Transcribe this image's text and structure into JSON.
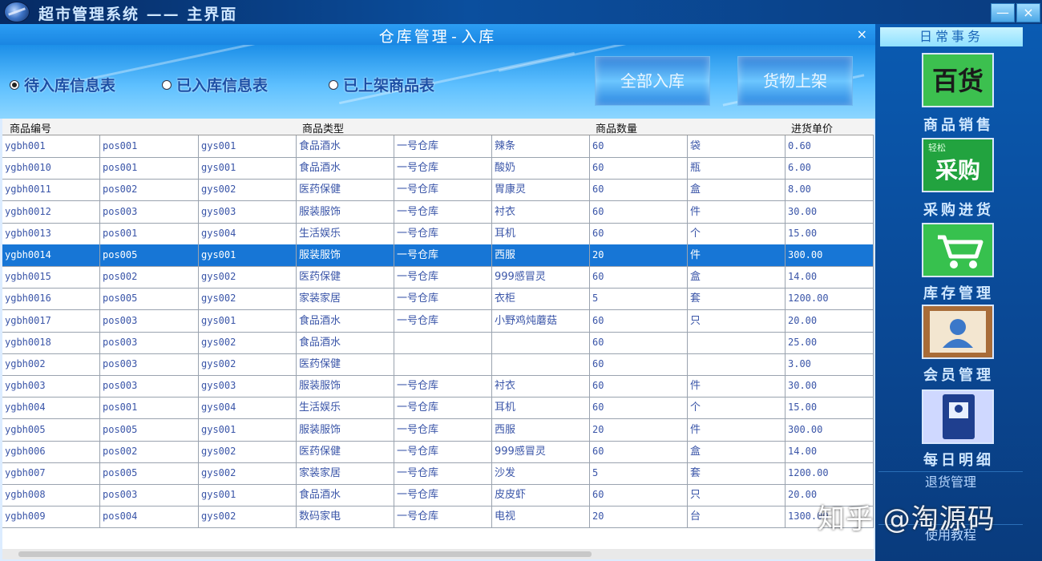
{
  "window": {
    "title": "超市管理系统 —— 主界面",
    "minimize": "—",
    "close": "×"
  },
  "panel": {
    "title": "仓库管理-入库",
    "close": "×",
    "radios": [
      {
        "label": "待入库信息表",
        "checked": true
      },
      {
        "label": "已入库信息表",
        "checked": false
      },
      {
        "label": "已上架商品表",
        "checked": false
      }
    ],
    "buttons": {
      "stock_in_all": "全部入库",
      "shelve_goods": "货物上架"
    }
  },
  "table": {
    "headers": [
      "商品编号",
      "",
      "",
      "商品类型",
      "",
      "",
      "商品数量",
      "",
      "进货单价"
    ],
    "selected_row": 5,
    "rows": [
      [
        "ygbh001",
        "pos001",
        "gys001",
        "食品酒水",
        "一号仓库",
        "辣条",
        "60",
        "袋",
        "0.60"
      ],
      [
        "ygbh0010",
        "pos001",
        "gys001",
        "食品酒水",
        "一号仓库",
        "酸奶",
        "60",
        "瓶",
        "6.00"
      ],
      [
        "ygbh0011",
        "pos002",
        "gys002",
        "医药保健",
        "一号仓库",
        "胃康灵",
        "60",
        "盒",
        "8.00"
      ],
      [
        "ygbh0012",
        "pos003",
        "gys003",
        "服装服饰",
        "一号仓库",
        "衬衣",
        "60",
        "件",
        "30.00"
      ],
      [
        "ygbh0013",
        "pos001",
        "gys004",
        "生活娱乐",
        "一号仓库",
        "耳机",
        "60",
        "个",
        "15.00"
      ],
      [
        "ygbh0014",
        "pos005",
        "gys001",
        "服装服饰",
        "一号仓库",
        "西服",
        "20",
        "件",
        "300.00"
      ],
      [
        "ygbh0015",
        "pos002",
        "gys002",
        "医药保健",
        "一号仓库",
        "999感冒灵",
        "60",
        "盒",
        "14.00"
      ],
      [
        "ygbh0016",
        "pos005",
        "gys002",
        "家装家居",
        "一号仓库",
        "衣柜",
        "5",
        "套",
        "1200.00"
      ],
      [
        "ygbh0017",
        "pos003",
        "gys001",
        "食品酒水",
        "一号仓库",
        "小野鸡炖蘑菇",
        "60",
        "只",
        "20.00"
      ],
      [
        "ygbh0018",
        "pos003",
        "gys002",
        "食品酒水",
        "",
        "",
        "60",
        "",
        "25.00"
      ],
      [
        "ygbh002",
        "pos003",
        "gys002",
        "医药保健",
        "",
        "",
        "60",
        "",
        "3.00"
      ],
      [
        "ygbh003",
        "pos003",
        "gys003",
        "服装服饰",
        "一号仓库",
        "衬衣",
        "60",
        "件",
        "30.00"
      ],
      [
        "ygbh004",
        "pos001",
        "gys004",
        "生活娱乐",
        "一号仓库",
        "耳机",
        "60",
        "个",
        "15.00"
      ],
      [
        "ygbh005",
        "pos005",
        "gys001",
        "服装服饰",
        "一号仓库",
        "西服",
        "20",
        "件",
        "300.00"
      ],
      [
        "ygbh006",
        "pos002",
        "gys002",
        "医药保健",
        "一号仓库",
        "999感冒灵",
        "60",
        "盒",
        "14.00"
      ],
      [
        "ygbh007",
        "pos005",
        "gys002",
        "家装家居",
        "一号仓库",
        "沙发",
        "5",
        "套",
        "1200.00"
      ],
      [
        "ygbh008",
        "pos003",
        "gys001",
        "食品酒水",
        "一号仓库",
        "皮皮虾",
        "60",
        "只",
        "20.00"
      ],
      [
        "ygbh009",
        "pos004",
        "gys002",
        "数码家电",
        "一号仓库",
        "电视",
        "20",
        "台",
        "1300.00"
      ]
    ]
  },
  "sidebar": {
    "tab": "日常事务",
    "items": [
      {
        "label": "商品销售",
        "icon": "sales-icon",
        "icon_text": "百货"
      },
      {
        "label": "采购进货",
        "icon": "purchase-icon",
        "icon_text": "采购",
        "icon_badge": "轻松"
      },
      {
        "label": "库存管理",
        "icon": "cart-icon"
      },
      {
        "label": "会员管理",
        "icon": "member-icon"
      },
      {
        "label": "每日明细",
        "icon": "details-book-icon"
      }
    ],
    "links": [
      "退货管理",
      "使用教程"
    ]
  },
  "watermark": "知乎 @淘源码"
}
